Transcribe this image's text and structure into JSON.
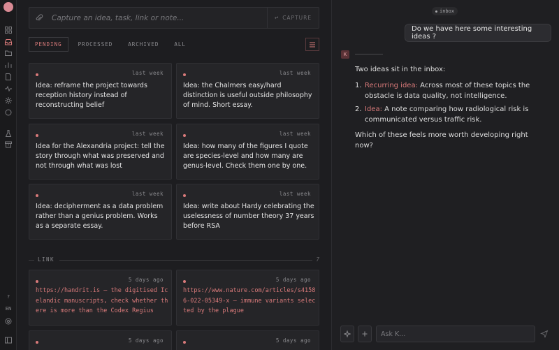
{
  "capture": {
    "placeholder": "Capture an idea, task, link or note...",
    "button_label": "CAPTURE",
    "button_glyph": "↵"
  },
  "tabs": [
    {
      "label": "PENDING",
      "active": true
    },
    {
      "label": "PROCESSED",
      "active": false
    },
    {
      "label": "ARCHIVED",
      "active": false
    },
    {
      "label": "ALL",
      "active": false
    }
  ],
  "cards": [
    {
      "time": "last week",
      "text": "Idea: reframe the project towards reception history instead of reconstructing belief"
    },
    {
      "time": "last week",
      "text": "Idea: the Chalmers easy/hard distinction is useful outside philosophy of mind. Short essay."
    },
    {
      "time": "last week",
      "text": "Idea for the Alexandria project: tell the story through what was preserved and not through what was lost"
    },
    {
      "time": "last week",
      "text": "Idea: how many of the figures I quote are species-level and how many are genus-level. Check them one by one."
    },
    {
      "time": "last week",
      "text": "Idea: decipherment as a data problem rather than a genius problem. Works as a separate essay."
    },
    {
      "time": "last week",
      "text": "Idea: write about Hardy celebrating the uselessness of number theory 37 years before RSA"
    }
  ],
  "link_section": {
    "label": "LINK",
    "count": "7"
  },
  "link_cards": [
    {
      "time": "5 days ago",
      "text": "https://handrit.is — the digitised Icelandic manuscripts, check whether there is more than the Codex Regius"
    },
    {
      "time": "5 days ago",
      "text": "https://www.nature.com/articles/s41586-022-05349-x — immune variants selected by the plague"
    },
    {
      "time": "5 days ago",
      "text": ""
    },
    {
      "time": "5 days ago",
      "text": ""
    }
  ],
  "chat": {
    "badge": "inbox",
    "user_message": "Do we have here some interesting ideas ?",
    "assistant_mark": "K",
    "reply_intro": "Two ideas sit in the inbox:",
    "items": [
      {
        "num": "1.",
        "label": "Recurring idea:",
        "text": "Across most of these topics the obstacle is data quality, not intelligence."
      },
      {
        "num": "2.",
        "label": "Idea:",
        "text": "A note comparing how radiological risk is communicated versus traffic risk."
      }
    ],
    "reply_outro": "Which of these feels more worth developing right now?",
    "ask_placeholder": "Ask K..."
  },
  "rail": {
    "bottom_help": "?",
    "bottom_lang": "EN"
  },
  "colors": {
    "accent": "#d97a7a",
    "background": "#1c1c1e",
    "card": "#252528"
  }
}
